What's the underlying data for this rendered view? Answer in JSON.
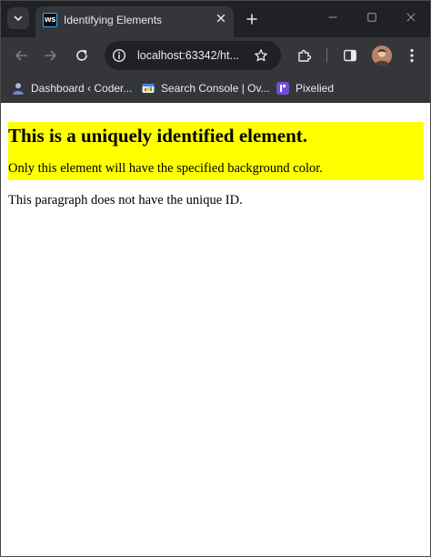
{
  "browser": {
    "tab": {
      "favicon_text": "WS",
      "title": "Identifying Elements"
    },
    "address_bar": {
      "url": "localhost:63342/ht..."
    },
    "bookmarks": [
      {
        "label": "Dashboard ‹ Coder...",
        "icon": "wordpress-user-icon"
      },
      {
        "label": "Search Console | Ov...",
        "icon": "search-console-icon"
      },
      {
        "label": "Pixelied",
        "icon": "pixelied-icon"
      }
    ],
    "colors": {
      "tabstrip": "#202124",
      "toolbar": "#35363a",
      "text": "#e8eaed"
    }
  },
  "page": {
    "unique_element": {
      "heading": "This is a uniquely identified element.",
      "paragraph": "Only this element will have the specified background color.",
      "background": "#ffff00"
    },
    "plain_paragraph": "This paragraph does not have the unique ID."
  }
}
